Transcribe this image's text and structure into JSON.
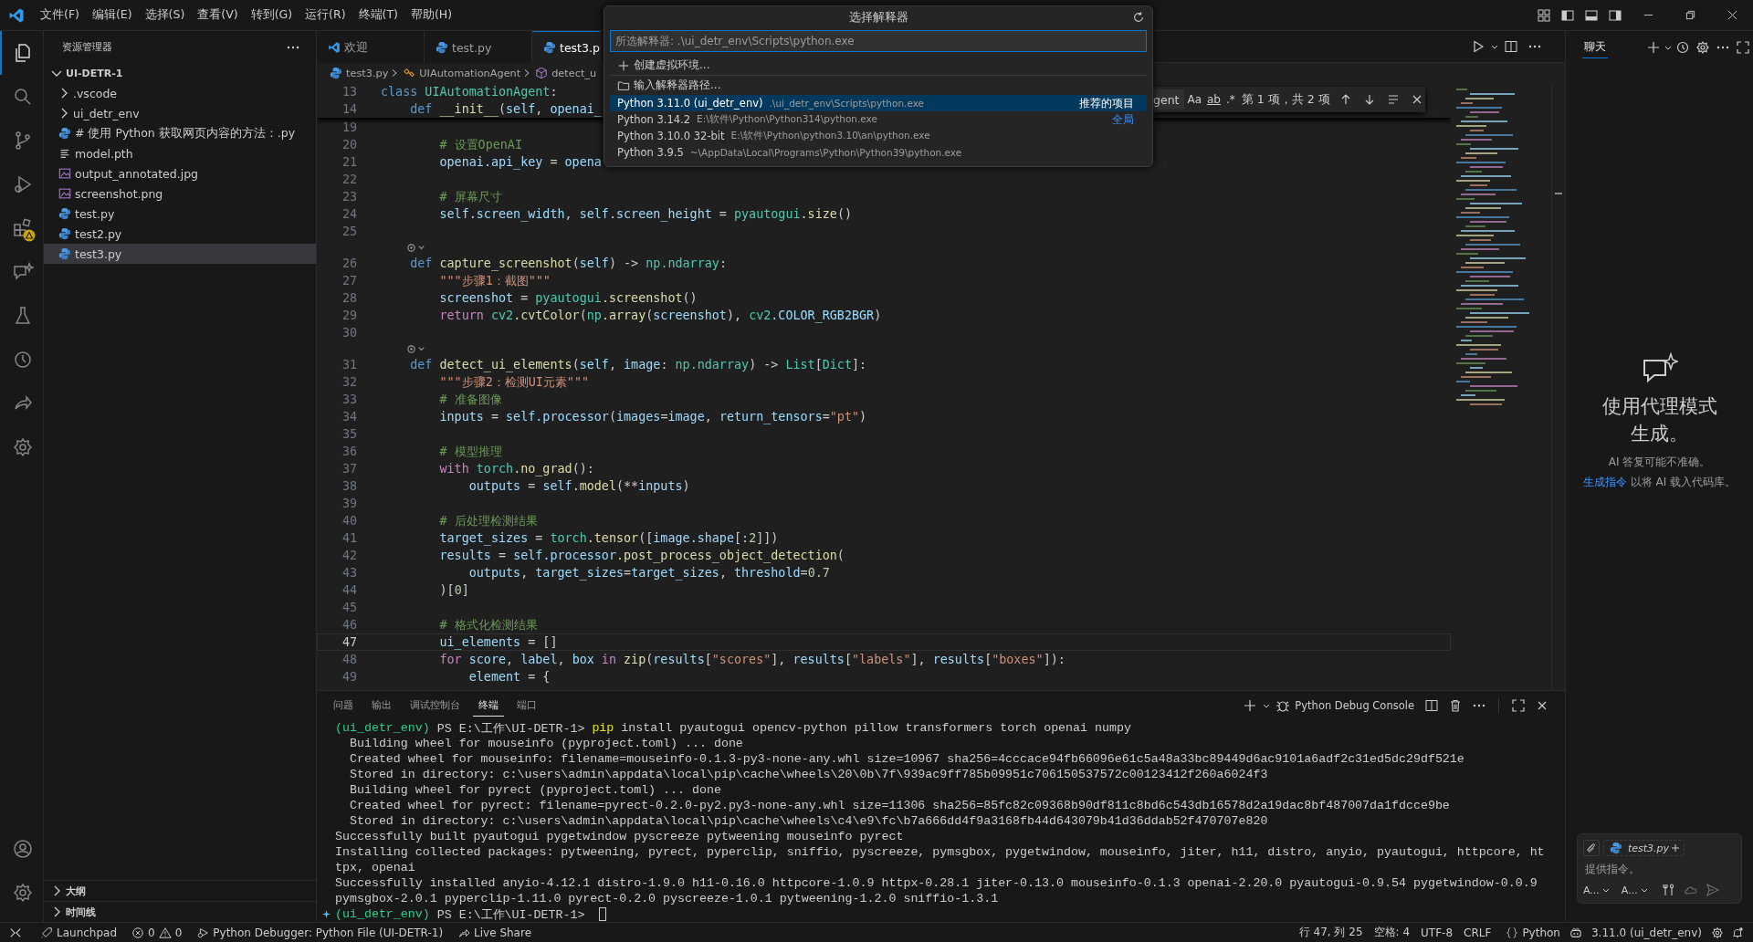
{
  "menu": [
    "文件(F)",
    "编辑(E)",
    "选择(S)",
    "查看(V)",
    "转到(G)",
    "运行(R)",
    "终端(T)",
    "帮助(H)"
  ],
  "activity_bar": [
    {
      "kind": "explorer",
      "selected": true,
      "warning": false
    },
    {
      "kind": "search",
      "selected": false,
      "warning": false
    },
    {
      "kind": "source_control",
      "selected": false,
      "warning": false
    },
    {
      "kind": "run_debug",
      "selected": false,
      "warning": false
    },
    {
      "kind": "extensions",
      "selected": false,
      "warning": true
    },
    {
      "kind": "chat",
      "selected": false,
      "warning": false
    },
    {
      "kind": "testing",
      "selected": false,
      "warning": false
    },
    {
      "kind": "history",
      "selected": false,
      "warning": false
    },
    {
      "kind": "share",
      "selected": false,
      "warning": false
    },
    {
      "kind": "cog",
      "selected": false,
      "warning": false
    }
  ],
  "activity_bar_bottom": [
    {
      "kind": "account"
    },
    {
      "kind": "settings"
    }
  ],
  "explorer": {
    "title": "资源管理器",
    "tree": [
      {
        "label": "UI-DETR-1",
        "expanded": true,
        "selected": false,
        "children": [
          {
            "label": ".vscode",
            "kind": "folder",
            "expanded": false,
            "selected": false
          },
          {
            "label": "ui_detr_env",
            "kind": "folder",
            "expanded": false,
            "selected": false
          },
          {
            "label": "# 使用 Python 获取网页内容的方法：.py",
            "kind": "python",
            "selected": false
          },
          {
            "label": "model.pth",
            "kind": "text",
            "selected": false
          },
          {
            "label": "output_annotated.jpg",
            "kind": "image",
            "selected": false
          },
          {
            "label": "screenshot.png",
            "kind": "image",
            "selected": false
          },
          {
            "label": "test.py",
            "kind": "python",
            "selected": false
          },
          {
            "label": "test2.py",
            "kind": "python",
            "selected": false
          },
          {
            "label": "test3.py",
            "kind": "python",
            "selected": true
          }
        ]
      }
    ],
    "sections": [
      {
        "label": "大纲",
        "expanded": false
      },
      {
        "label": "时间线",
        "expanded": false
      }
    ]
  },
  "editor_tabs": [
    {
      "label": "欢迎",
      "kind": "welcome",
      "selected": false
    },
    {
      "label": "test.py",
      "kind": "python",
      "selected": false
    },
    {
      "label": "test3.p",
      "kind": "python",
      "selected": true
    }
  ],
  "breadcrumbs": [
    {
      "label": "test3.py",
      "kind": "file"
    },
    {
      "label": "UIAutomationAgent",
      "kind": "class"
    },
    {
      "label": "detect_u",
      "kind": "method"
    }
  ],
  "editor": {
    "sticky_lines": [
      {
        "number": "13",
        "tokens": [
          {
            "kind": "keyword",
            "text": "class"
          },
          {
            "kind": "type",
            "text": " UIAutomationAgent"
          },
          {
            "kind": "plain",
            "text": ":"
          }
        ]
      },
      {
        "number": "14",
        "tokens": [
          {
            "kind": "keyword",
            "text": "    def"
          },
          {
            "kind": "function",
            "text": " __init__"
          },
          {
            "kind": "plain",
            "text": "("
          },
          {
            "kind": "variable",
            "text": "self"
          },
          {
            "kind": "plain",
            "text": ", "
          },
          {
            "kind": "variable",
            "text": "openai_"
          }
        ]
      }
    ],
    "lines": [
      {
        "kind": "code",
        "number": "19",
        "current": false
      },
      {
        "kind": "code",
        "number": "20",
        "current": false,
        "tokens": [
          {
            "kind": "comment",
            "text": "        # 设置OpenAI"
          }
        ]
      },
      {
        "kind": "code",
        "number": "21",
        "current": false,
        "tokens": [
          {
            "kind": "variable",
            "text": "        openai"
          },
          {
            "kind": "variable",
            "text": ".api_key"
          },
          {
            "kind": "plain",
            "text": " = "
          },
          {
            "kind": "variable",
            "text": "opena"
          }
        ]
      },
      {
        "kind": "code",
        "number": "22",
        "current": false
      },
      {
        "kind": "code",
        "number": "23",
        "current": false,
        "tokens": [
          {
            "kind": "comment",
            "text": "        # 屏幕尺寸"
          }
        ]
      },
      {
        "kind": "code",
        "number": "24",
        "current": false,
        "tokens": [
          {
            "kind": "variable",
            "text": "        self"
          },
          {
            "kind": "variable",
            "text": ".screen_width"
          },
          {
            "kind": "plain",
            "text": ", "
          },
          {
            "kind": "variable",
            "text": "self"
          },
          {
            "kind": "variable",
            "text": ".screen_height"
          },
          {
            "kind": "plain",
            "text": " = "
          },
          {
            "kind": "type",
            "text": "pyautogui"
          },
          {
            "kind": "function",
            "text": ".size"
          },
          {
            "kind": "plain",
            "text": "()"
          }
        ]
      },
      {
        "kind": "code",
        "number": "25",
        "current": false
      },
      {
        "kind": "lens"
      },
      {
        "kind": "code",
        "number": "26",
        "current": false,
        "tokens": [
          {
            "kind": "keyword",
            "text": "    def"
          },
          {
            "kind": "function",
            "text": " capture_screenshot"
          },
          {
            "kind": "plain",
            "text": "("
          },
          {
            "kind": "variable",
            "text": "self"
          },
          {
            "kind": "plain",
            "text": ") -> "
          },
          {
            "kind": "type",
            "text": "np"
          },
          {
            "kind": "type",
            "text": ".ndarray"
          },
          {
            "kind": "plain",
            "text": ":"
          }
        ]
      },
      {
        "kind": "code",
        "number": "27",
        "current": false,
        "tokens": [
          {
            "kind": "string",
            "text": "        \"\"\"步骤1：截图\"\"\""
          }
        ]
      },
      {
        "kind": "code",
        "number": "28",
        "current": false,
        "tokens": [
          {
            "kind": "variable",
            "text": "        screenshot"
          },
          {
            "kind": "plain",
            "text": " = "
          },
          {
            "kind": "type",
            "text": "pyautogui"
          },
          {
            "kind": "function",
            "text": ".screenshot"
          },
          {
            "kind": "plain",
            "text": "()"
          }
        ]
      },
      {
        "kind": "code",
        "number": "29",
        "current": false,
        "tokens": [
          {
            "kind": "control",
            "text": "        return"
          },
          {
            "kind": "type",
            "text": " cv2"
          },
          {
            "kind": "function",
            "text": ".cvtColor"
          },
          {
            "kind": "plain",
            "text": "("
          },
          {
            "kind": "type",
            "text": "np"
          },
          {
            "kind": "function",
            "text": ".array"
          },
          {
            "kind": "plain",
            "text": "("
          },
          {
            "kind": "variable",
            "text": "screenshot"
          },
          {
            "kind": "plain",
            "text": "), "
          },
          {
            "kind": "type",
            "text": "cv2"
          },
          {
            "kind": "variable",
            "text": ".COLOR_RGB2BGR"
          },
          {
            "kind": "plain",
            "text": ")"
          }
        ]
      },
      {
        "kind": "code",
        "number": "30",
        "current": false
      },
      {
        "kind": "lens"
      },
      {
        "kind": "code",
        "number": "31",
        "current": false,
        "tokens": [
          {
            "kind": "keyword",
            "text": "    def"
          },
          {
            "kind": "function",
            "text": " detect_ui_elements"
          },
          {
            "kind": "plain",
            "text": "("
          },
          {
            "kind": "variable",
            "text": "self"
          },
          {
            "kind": "plain",
            "text": ", "
          },
          {
            "kind": "variable",
            "text": "image"
          },
          {
            "kind": "plain",
            "text": ": "
          },
          {
            "kind": "type",
            "text": "np"
          },
          {
            "kind": "type",
            "text": ".ndarray"
          },
          {
            "kind": "plain",
            "text": ") -> "
          },
          {
            "kind": "type",
            "text": "List"
          },
          {
            "kind": "plain",
            "text": "["
          },
          {
            "kind": "type",
            "text": "Dict"
          },
          {
            "kind": "plain",
            "text": "]:"
          }
        ]
      },
      {
        "kind": "code",
        "number": "32",
        "current": false,
        "tokens": [
          {
            "kind": "string",
            "text": "        \"\"\"步骤2：检测UI元素\"\"\""
          }
        ]
      },
      {
        "kind": "code",
        "number": "33",
        "current": false,
        "tokens": [
          {
            "kind": "comment",
            "text": "        # 准备图像"
          }
        ]
      },
      {
        "kind": "code",
        "number": "34",
        "current": false,
        "tokens": [
          {
            "kind": "variable",
            "text": "        inputs"
          },
          {
            "kind": "plain",
            "text": " = "
          },
          {
            "kind": "variable",
            "text": "self"
          },
          {
            "kind": "variable",
            "text": ".processor"
          },
          {
            "kind": "plain",
            "text": "("
          },
          {
            "kind": "variable",
            "text": "images"
          },
          {
            "kind": "plain",
            "text": "="
          },
          {
            "kind": "variable",
            "text": "image"
          },
          {
            "kind": "plain",
            "text": ", "
          },
          {
            "kind": "variable",
            "text": "return_tensors"
          },
          {
            "kind": "plain",
            "text": "="
          },
          {
            "kind": "string",
            "text": "\"pt\""
          },
          {
            "kind": "plain",
            "text": ")"
          }
        ]
      },
      {
        "kind": "code",
        "number": "35",
        "current": false
      },
      {
        "kind": "code",
        "number": "36",
        "current": false,
        "tokens": [
          {
            "kind": "comment",
            "text": "        # 模型推理"
          }
        ]
      },
      {
        "kind": "code",
        "number": "37",
        "current": false,
        "tokens": [
          {
            "kind": "control",
            "text": "        with"
          },
          {
            "kind": "type",
            "text": " torch"
          },
          {
            "kind": "function",
            "text": ".no_grad"
          },
          {
            "kind": "plain",
            "text": "():"
          }
        ]
      },
      {
        "kind": "code",
        "number": "38",
        "current": false,
        "tokens": [
          {
            "kind": "variable",
            "text": "            outputs"
          },
          {
            "kind": "plain",
            "text": " = "
          },
          {
            "kind": "variable",
            "text": "self"
          },
          {
            "kind": "function",
            "text": ".model"
          },
          {
            "kind": "plain",
            "text": "(**"
          },
          {
            "kind": "variable",
            "text": "inputs"
          },
          {
            "kind": "plain",
            "text": ")"
          }
        ]
      },
      {
        "kind": "code",
        "number": "39",
        "current": false
      },
      {
        "kind": "code",
        "number": "40",
        "current": false,
        "tokens": [
          {
            "kind": "comment",
            "text": "        # 后处理检测结果"
          }
        ]
      },
      {
        "kind": "code",
        "number": "41",
        "current": false,
        "tokens": [
          {
            "kind": "variable",
            "text": "        target_sizes"
          },
          {
            "kind": "plain",
            "text": " = "
          },
          {
            "kind": "type",
            "text": "torch"
          },
          {
            "kind": "function",
            "text": ".tensor"
          },
          {
            "kind": "plain",
            "text": "(["
          },
          {
            "kind": "variable",
            "text": "image"
          },
          {
            "kind": "variable",
            "text": ".shape"
          },
          {
            "kind": "plain",
            "text": "[:"
          },
          {
            "kind": "number",
            "text": "2"
          },
          {
            "kind": "plain",
            "text": "]])"
          }
        ]
      },
      {
        "kind": "code",
        "number": "42",
        "current": false,
        "tokens": [
          {
            "kind": "variable",
            "text": "        results"
          },
          {
            "kind": "plain",
            "text": " = "
          },
          {
            "kind": "variable",
            "text": "self"
          },
          {
            "kind": "variable",
            "text": ".processor"
          },
          {
            "kind": "function",
            "text": ".post_process_object_detection"
          },
          {
            "kind": "plain",
            "text": "("
          }
        ]
      },
      {
        "kind": "code",
        "number": "43",
        "current": false,
        "tokens": [
          {
            "kind": "variable",
            "text": "            outputs"
          },
          {
            "kind": "plain",
            "text": ", "
          },
          {
            "kind": "variable",
            "text": "target_sizes"
          },
          {
            "kind": "plain",
            "text": "="
          },
          {
            "kind": "variable",
            "text": "target_sizes"
          },
          {
            "kind": "plain",
            "text": ", "
          },
          {
            "kind": "variable",
            "text": "threshold"
          },
          {
            "kind": "plain",
            "text": "="
          },
          {
            "kind": "number",
            "text": "0.7"
          }
        ]
      },
      {
        "kind": "code",
        "number": "44",
        "current": false,
        "tokens": [
          {
            "kind": "plain",
            "text": "        )["
          },
          {
            "kind": "number",
            "text": "0"
          },
          {
            "kind": "plain",
            "text": "]"
          }
        ]
      },
      {
        "kind": "code",
        "number": "45",
        "current": false
      },
      {
        "kind": "code",
        "number": "46",
        "current": false,
        "tokens": [
          {
            "kind": "comment",
            "text": "        # 格式化检测结果"
          }
        ]
      },
      {
        "kind": "code",
        "number": "47",
        "current": true,
        "tokens": [
          {
            "kind": "variable",
            "text": "        ui_elements"
          },
          {
            "kind": "plain",
            "text": " = []"
          }
        ]
      },
      {
        "kind": "code",
        "number": "48",
        "current": false,
        "tokens": [
          {
            "kind": "control",
            "text": "        for"
          },
          {
            "kind": "variable",
            "text": " score"
          },
          {
            "kind": "plain",
            "text": ", "
          },
          {
            "kind": "variable",
            "text": "label"
          },
          {
            "kind": "plain",
            "text": ", "
          },
          {
            "kind": "variable",
            "text": "box"
          },
          {
            "kind": "control",
            "text": " in"
          },
          {
            "kind": "function",
            "text": " zip"
          },
          {
            "kind": "plain",
            "text": "("
          },
          {
            "kind": "variable",
            "text": "results"
          },
          {
            "kind": "plain",
            "text": "["
          },
          {
            "kind": "string",
            "text": "\"scores\""
          },
          {
            "kind": "plain",
            "text": "], "
          },
          {
            "kind": "variable",
            "text": "results"
          },
          {
            "kind": "plain",
            "text": "["
          },
          {
            "kind": "string",
            "text": "\"labels\""
          },
          {
            "kind": "plain",
            "text": "], "
          },
          {
            "kind": "variable",
            "text": "results"
          },
          {
            "kind": "plain",
            "text": "["
          },
          {
            "kind": "string",
            "text": "\"boxes\""
          },
          {
            "kind": "plain",
            "text": "]):"
          }
        ]
      },
      {
        "kind": "code",
        "number": "49",
        "current": false,
        "tokens": [
          {
            "kind": "variable",
            "text": "            element"
          },
          {
            "kind": "plain",
            "text": " = {"
          }
        ]
      }
    ]
  },
  "find_widget": {
    "value": "gent",
    "toggles": [
      "Aa",
      "ab",
      ".*"
    ],
    "result": "第 1 项，共 2 项"
  },
  "interpreter_picker": {
    "title": "选择解释器",
    "placeholder": "所选解释器: .\\ui_detr_env\\Scripts\\python.exe",
    "actions": [
      {
        "kind": "create",
        "label": "创建虚拟环境..."
      },
      {
        "kind": "browse",
        "label": "输入解释器路径..."
      }
    ],
    "interpreters": [
      {
        "label": "Python 3.11.0 (ui_detr_env)",
        "path": ".\\ui_detr_env\\Scripts\\python.exe",
        "tag": "推荐的项目",
        "selected": true
      },
      {
        "label": "Python 3.14.2",
        "path": "E:\\软件\\Python\\Python314\\python.exe",
        "tag": "全局",
        "selected": false
      },
      {
        "label": "Python 3.10.0 32-bit",
        "path": "E:\\软件\\Python\\python3.10\\an\\python.exe",
        "selected": false
      },
      {
        "label": "Python 3.9.5",
        "path": "~\\AppData\\Local\\Programs\\Python\\Python39\\python.exe",
        "selected": false
      }
    ]
  },
  "panel": {
    "tabs": [
      {
        "label": "问题",
        "selected": false
      },
      {
        "label": "输出",
        "selected": false
      },
      {
        "label": "调试控制台",
        "selected": false
      },
      {
        "label": "终端",
        "selected": true
      },
      {
        "label": "端口",
        "selected": false
      }
    ],
    "profile": "Python Debug Console",
    "lines": [
      {
        "kind": "prompt",
        "env": "(ui_detr_env)",
        "path": "PS E:\\工作\\UI-DETR-1>",
        "command": "pip",
        "args": "install pyautogui opencv-python pillow transformers torch openai numpy"
      },
      {
        "kind": "output",
        "text": "  Building wheel for mouseinfo (pyproject.toml) ... done"
      },
      {
        "kind": "output",
        "text": "  Created wheel for mouseinfo: filename=mouseinfo-0.1.3-py3-none-any.whl size=10967 sha256=4cccace94fb66096e61c5a48a33bc89449d6ac9101a6adf2c31ed5dc29df521e"
      },
      {
        "kind": "output",
        "text": "  Stored in directory: c:\\users\\admin\\appdata\\local\\pip\\cache\\wheels\\20\\0b\\7f\\939ac9ff785b09951c706150537572c00123412f260a6024f3"
      },
      {
        "kind": "output",
        "text": "  Building wheel for pyrect (pyproject.toml) ... done"
      },
      {
        "kind": "output",
        "text": "  Created wheel for pyrect: filename=pyrect-0.2.0-py2.py3-none-any.whl size=11306 sha256=85fc82c09368b90df811c8bd6c543db16578d2a19dac8bf487007da1fdcce9be"
      },
      {
        "kind": "output",
        "text": "  Stored in directory: c:\\users\\admin\\appdata\\local\\pip\\cache\\wheels\\c4\\e9\\fc\\b7a666dd4f9a3168fb44d643079b41d36ddab52f470707e820"
      },
      {
        "kind": "output",
        "text": "Successfully built pyautogui pygetwindow pyscreeze pytweening mouseinfo pyrect"
      },
      {
        "kind": "output",
        "text": "Installing collected packages: pytweening, pyrect, pyperclip, sniffio, pyscreeze, pymsgbox, pygetwindow, mouseinfo, jiter, h11, distro, anyio, pyautogui, httpcore, ht"
      },
      {
        "kind": "output",
        "text": "tpx, openai"
      },
      {
        "kind": "output",
        "text": "Successfully installed anyio-4.12.1 distro-1.9.0 h11-0.16.0 httpcore-1.0.9 httpx-0.28.1 jiter-0.13.0 mouseinfo-0.1.3 openai-2.20.0 pyautogui-0.9.54 pygetwindow-0.0.9"
      },
      {
        "kind": "output",
        "text": "pymsgbox-2.0.1 pyperclip-1.11.0 pyrect-0.2.0 pyscreeze-1.0.1 pytweening-1.2.0 sniffio-1.3.1"
      },
      {
        "kind": "active_prompt",
        "env": "(ui_detr_env)",
        "path": "PS E:\\工作\\UI-DETR-1>"
      }
    ]
  },
  "chat": {
    "tab": "聊天",
    "heading": "使用代理模式生成。",
    "note": "AI 答复可能不准确。",
    "hint_link": "生成指令",
    "hint_text": "以将 AI 载入代码库。",
    "attachment": "test3.py",
    "placeholder": "提供指令。",
    "pickers": [
      "A...",
      "A..."
    ]
  },
  "status_bar": {
    "launchpad": "Launchpad",
    "errors": "0",
    "warnings": "0",
    "debugger": "Python Debugger: Python File (UI-DETR-1)",
    "live_share": "Live Share",
    "position": "行 47, 列 25",
    "indent": "空格: 4",
    "encoding": "UTF-8",
    "eol": "CRLF",
    "language": "Python",
    "interpreter": "3.11.0 (ui_detr_env)"
  }
}
